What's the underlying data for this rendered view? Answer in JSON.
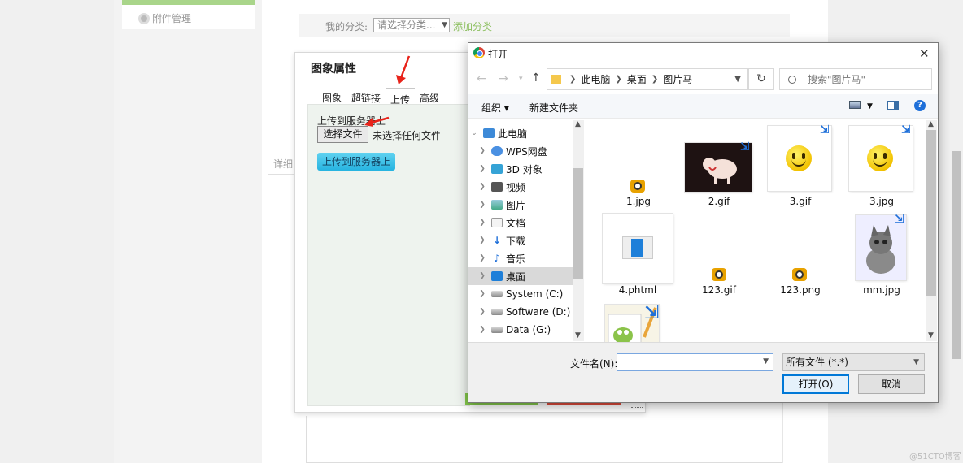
{
  "cms": {
    "sidebar_link": "附件管理",
    "category_label": "我的分类:",
    "category_select": "请选择分类...",
    "add_category": "添加分类",
    "detail_label": "详细内容"
  },
  "image_dialog": {
    "title": "图象属性",
    "tabs": [
      "图象",
      "超链接",
      "上传",
      "高级"
    ],
    "active_tab": "上传",
    "upload_label": "上传到服务器上",
    "choose_file_button": "选择文件",
    "no_file_text": "未选择任何文件",
    "upload_button": "上传到服务器上"
  },
  "open_dialog": {
    "title": "打开",
    "breadcrumb": [
      "此电脑",
      "桌面",
      "图片马"
    ],
    "search_placeholder": "搜索\"图片马\"",
    "toolbar": {
      "organize": "组织 ▾",
      "new_folder": "新建文件夹",
      "help": "?"
    },
    "tree": [
      {
        "label": "此电脑",
        "expanded": true
      },
      {
        "label": "WPS网盘"
      },
      {
        "label": "3D 对象"
      },
      {
        "label": "视频"
      },
      {
        "label": "图片"
      },
      {
        "label": "文档"
      },
      {
        "label": "下载"
      },
      {
        "label": "音乐"
      },
      {
        "label": "桌面",
        "selected": true
      },
      {
        "label": "System (C:)"
      },
      {
        "label": "Software (D:)"
      },
      {
        "label": "Data (G:)"
      }
    ],
    "files": [
      "1.jpg",
      "2.gif",
      "3.gif",
      "3.jpg",
      "4.phtml",
      "123.gif",
      "123.png",
      "mm.jpg"
    ],
    "filename_label": "文件名(N):",
    "filename_value": "",
    "file_type": "所有文件 (*.*)",
    "open_button": "打开(O)",
    "cancel_button": "取消"
  },
  "watermark": "@51CTO博客",
  "colors": {
    "accent_green": "#8cbf5f",
    "upload_blue": "#26b3e0",
    "arrow_red": "#e8231a",
    "win_blue": "#0078d7"
  }
}
